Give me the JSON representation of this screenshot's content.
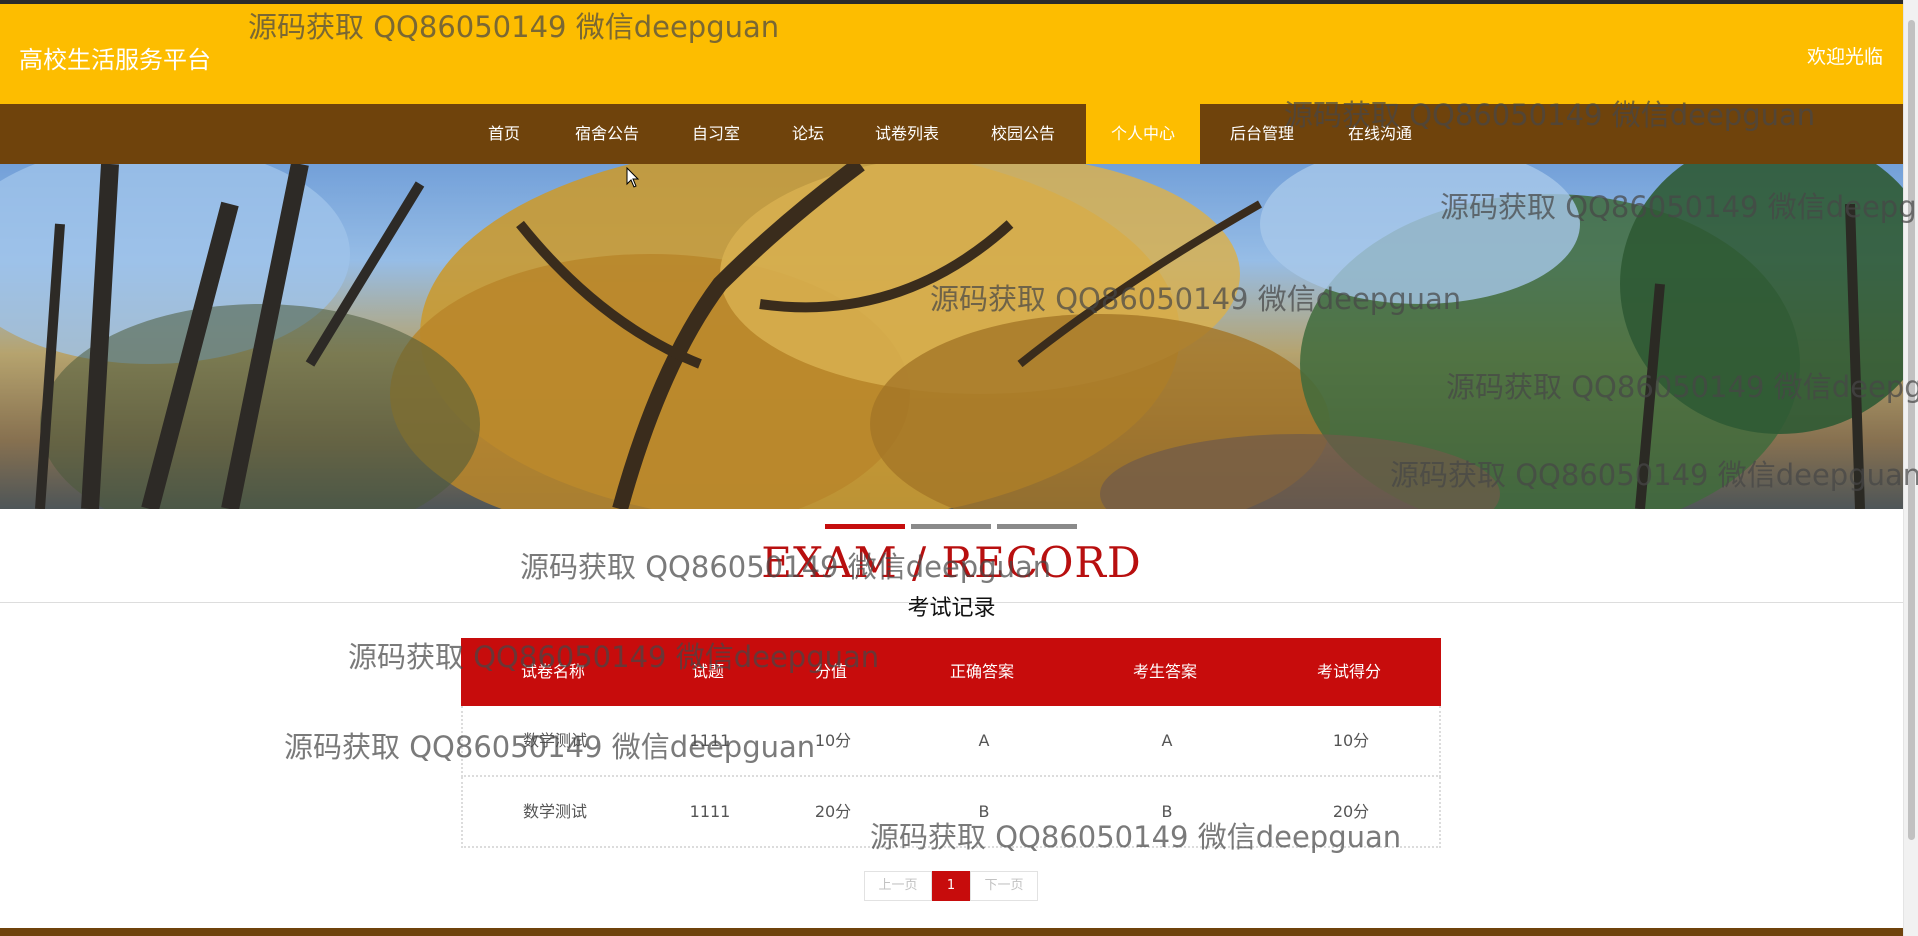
{
  "header": {
    "site_title": "高校生活服务平台",
    "welcome": "欢迎光临",
    "bg_color": "#fdbd00"
  },
  "nav": {
    "bg_color": "#6f430c",
    "items": [
      {
        "label": "首页"
      },
      {
        "label": "宿舍公告"
      },
      {
        "label": "自习室"
      },
      {
        "label": "论坛"
      },
      {
        "label": "试卷列表"
      },
      {
        "label": "校园公告"
      },
      {
        "label": "个人中心"
      },
      {
        "label": "后台管理"
      },
      {
        "label": "在线沟通"
      }
    ],
    "active": "个人中心"
  },
  "banner": {
    "slide_count": 3,
    "active_slide": 1
  },
  "section": {
    "title_en": "EXAM / RECORD",
    "title_zh": "考试记录"
  },
  "table": {
    "header_color": "#c70c0c",
    "columns": [
      "试卷名称",
      "试题",
      "分值",
      "正确答案",
      "考生答案",
      "考试得分"
    ],
    "rows": [
      [
        "数学测试",
        "1111",
        "10分",
        "A",
        "A",
        "10分"
      ],
      [
        "数学测试",
        "1111",
        "20分",
        "B",
        "B",
        "20分"
      ]
    ]
  },
  "pagination": {
    "prev": "上一页",
    "current": "1",
    "next": "下一页"
  },
  "watermark": {
    "text": "源码获取 QQ86050149 微信deepguan"
  }
}
